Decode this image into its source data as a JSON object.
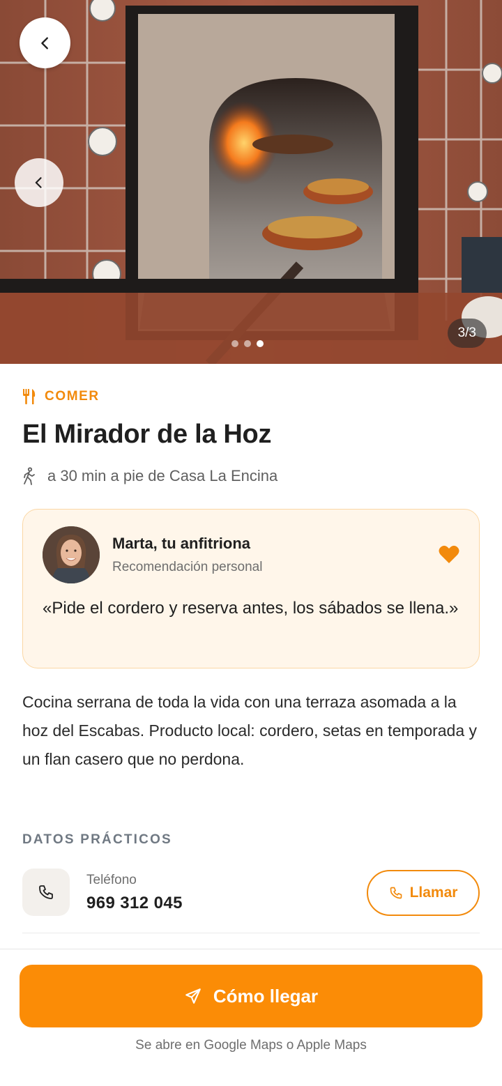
{
  "hero": {
    "image_counter": "3/3",
    "slide_count": 3,
    "active_slide": 3
  },
  "place": {
    "category": "COMER",
    "title": "El Mirador de la Hoz",
    "walk_info": "a 30 min a pie de Casa La Encina"
  },
  "host": {
    "name": "Marta, tu anfitriona",
    "subtitle": "Recomendación personal",
    "quote": "«Pide el cordero y reserva antes, los sábados se llena.»"
  },
  "description": "Cocina serrana de toda la vida con una terraza asomada a la hoz del Escabas. Producto local: cordero, setas en temporada y un flan casero que no perdona.",
  "practical": {
    "heading": "DATOS PRÁCTICOS",
    "phone_label": "Teléfono",
    "phone_number": "969 312 045",
    "call_label": "Llamar"
  },
  "footer": {
    "cta_label": "Cómo llegar",
    "cta_note": "Se abre en Google Maps o Apple Maps"
  },
  "icons": {
    "back": "chevron-left-icon",
    "prev": "chevron-left-icon",
    "category": "fork-knife-icon",
    "walk": "walking-person-icon",
    "heart": "heart-icon",
    "phone": "phone-icon",
    "cta": "send-arrow-icon"
  },
  "colors": {
    "accent": "#f28a0c",
    "cta_bg": "#fb8c06",
    "card_bg": "#fff6ea",
    "card_border": "#fbd7a4"
  }
}
